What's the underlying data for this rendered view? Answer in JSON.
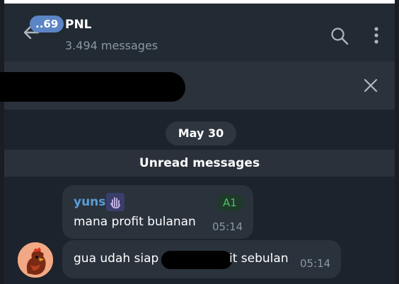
{
  "header": {
    "back_icon": "arrow-left-icon",
    "unread_count": "..69",
    "title": "PNL",
    "subtitle": "3.494 messages",
    "search_icon": "search-icon",
    "more_icon": "more-vertical-icon"
  },
  "pinned": {
    "close_icon": "close-icon"
  },
  "date_label": "May 30",
  "unread_separator": "Unread messages",
  "messages": [
    {
      "sender": "yuns",
      "sender_badge": "A1",
      "text": "mana profit bulanan",
      "time": "05:14"
    },
    {
      "text_before": "gua udah siap",
      "text_after": "it sebulan",
      "time": "05:14"
    }
  ],
  "colors": {
    "accent": "#5b85c4",
    "sender_name": "#5a9ed8",
    "admin_badge": "#4fbf65",
    "background": "#1d232c"
  }
}
